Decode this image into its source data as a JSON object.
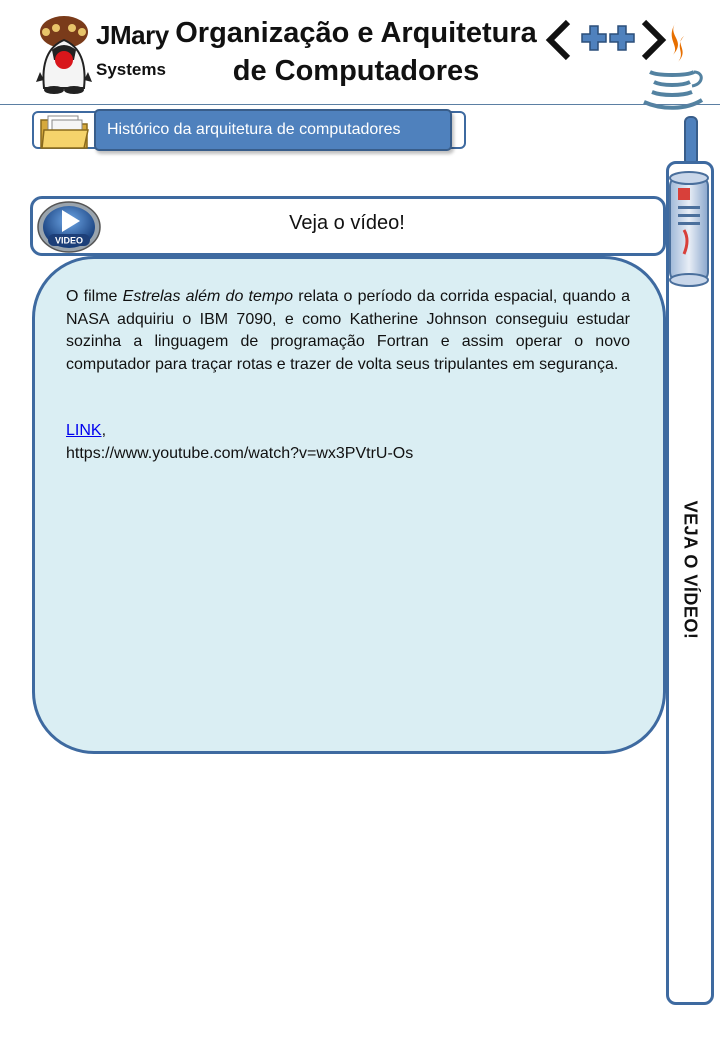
{
  "header": {
    "brand_name": "JMary",
    "brand_sub": "Systems",
    "title_line1": "Organização e Arquitetura",
    "title_line2": "de Computadores",
    "code_symbol": "<++>"
  },
  "breadcrumb": {
    "label": "Histórico da arquitetura de computadores"
  },
  "video_section": {
    "icon_label": "VIDEO",
    "title": "Veja o vídeo!"
  },
  "content": {
    "intro": "O filme ",
    "movie_title": "Estrelas além do tempo",
    "rest": " relata o período da corrida espacial, quando a NASA adquiriu o IBM 7090, e como Katherine Johnson conseguiu estudar sozinha a linguagem de programação Fortran e assim operar o novo computador para traçar rotas e trazer de volta seus tripulantes em segurança.",
    "link_label": "LINK",
    "link_separator": ",",
    "link_url": "https://www.youtube.com/watch?v=wx3PVtrU-Os"
  },
  "sidebar": {
    "label": "VEJA O VÍDEO!"
  },
  "colors": {
    "accent_blue": "#4f81bd",
    "border_blue": "#3e6aa0",
    "content_bg": "#daeef3",
    "link": "#0000ee"
  }
}
